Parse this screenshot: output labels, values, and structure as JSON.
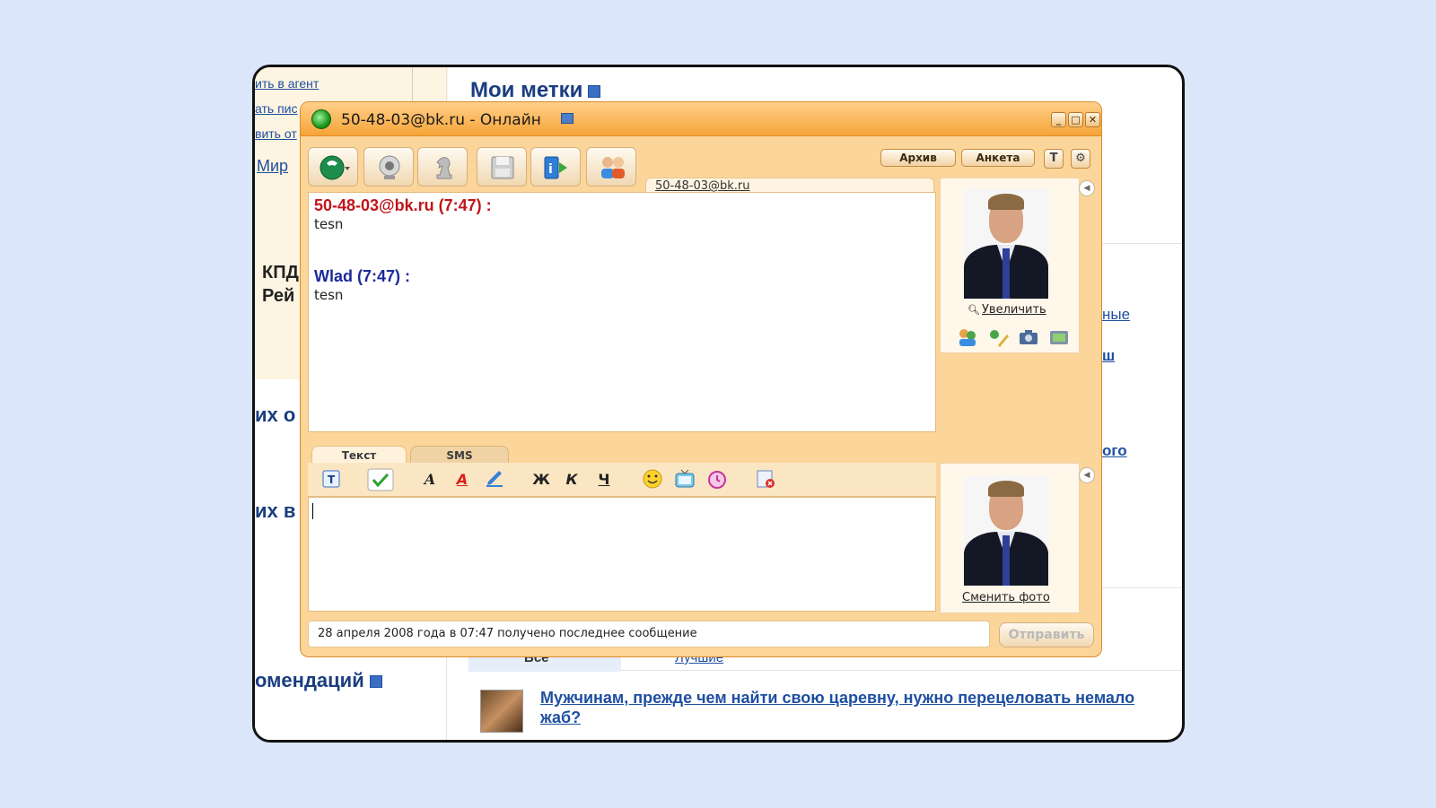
{
  "background_page": {
    "left_links": [
      "ить в агент",
      "ать пис",
      "вить от"
    ],
    "mir_link": "Мир",
    "kpd_label": "КПД",
    "reit_label": "Рей",
    "ih_ot": "их о",
    "ih_vo": "их в",
    "recommend_heading": "омендаций",
    "my_tags_title": "Мои метки",
    "right_fragments": [
      "ные",
      "ш",
      "ого"
    ],
    "tab_all": "Все",
    "tab_best": "Лучшие",
    "article_title": "Мужчинам, прежде чем найти свою царевну, нужно перецеловать немало жаб?"
  },
  "agent": {
    "title": "50-48-03@bk.ru - Онлайн",
    "window_controls": {
      "minimize": "_",
      "maximize": "□",
      "close": "✕"
    },
    "toolbar": {
      "icons": [
        "phone-icon",
        "webcam-icon",
        "chess-knight-icon",
        "floppy-save-icon",
        "info-transfer-icon",
        "users-icon"
      ],
      "archive_label": "Архив",
      "profile_label": "Анкета"
    },
    "contact_tab": "50-48-03@bk.ru",
    "messages": [
      {
        "author": "50-48-03@bk.ru (7:47) :",
        "text": "tesn",
        "color": "#c0151a"
      },
      {
        "author": "Wlad (7:47) :",
        "text": "tesn",
        "color": "#1b2a9a"
      }
    ],
    "contact_panel": {
      "zoom_label": "Увеличить"
    },
    "my_panel": {
      "change_photo_label": "Сменить фото"
    },
    "input_tabs": {
      "text": "Текст",
      "sms": "SMS"
    },
    "format_buttons": {
      "bold": "Ж",
      "italic": "К",
      "underline": "Ч"
    },
    "status_text": "28 апреля 2008 года в 07:47 получено последнее сообщение",
    "send_label": "Отправить"
  }
}
